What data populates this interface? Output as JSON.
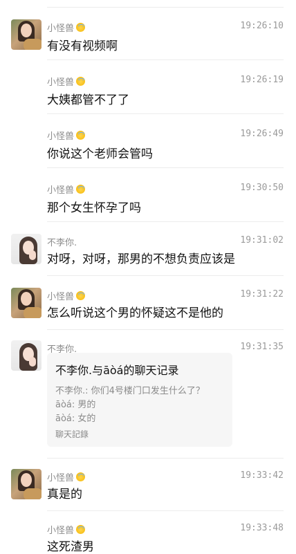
{
  "messages": [
    {
      "sender": "小怪兽",
      "time": "19:26:10",
      "text": "有没有视频啊",
      "emoji_icon": "innocent-face-emoji"
    },
    {
      "sender": "小怪兽",
      "time": "19:26:19",
      "text": "大姨都管不了了",
      "emoji_icon": "innocent-face-emoji"
    },
    {
      "sender": "小怪兽",
      "time": "19:26:49",
      "text": "你说这个老师会管吗",
      "emoji_icon": "innocent-face-emoji"
    },
    {
      "sender": "小怪兽",
      "time": "19:30:50",
      "text": "那个女生怀孕了吗",
      "emoji_icon": "innocent-face-emoji"
    },
    {
      "sender": "不李你.",
      "time": "19:31:02",
      "text": "对呀，对呀，那男的不想负责应该是"
    },
    {
      "sender": "小怪兽",
      "time": "19:31:22",
      "text": "怎么听说这个男的怀疑这不是他的",
      "emoji_icon": "innocent-face-emoji"
    },
    {
      "sender": "不李你.",
      "time": "19:31:35"
    },
    {
      "sender": "小怪兽",
      "time": "19:33:42",
      "text": "真是的",
      "emoji_icon": "innocent-face-emoji"
    },
    {
      "sender": "小怪兽",
      "time": "19:33:48",
      "text": "这死渣男",
      "emoji_icon": "innocent-face-emoji"
    }
  ],
  "chat_record_card": {
    "title": "不李你.与āòá的聊天记录",
    "lines": [
      "不李你.: 你们4号楼门口发生什么了？",
      "āòá: 男的",
      "āòá: 女的"
    ],
    "footer": "聊天記錄"
  }
}
